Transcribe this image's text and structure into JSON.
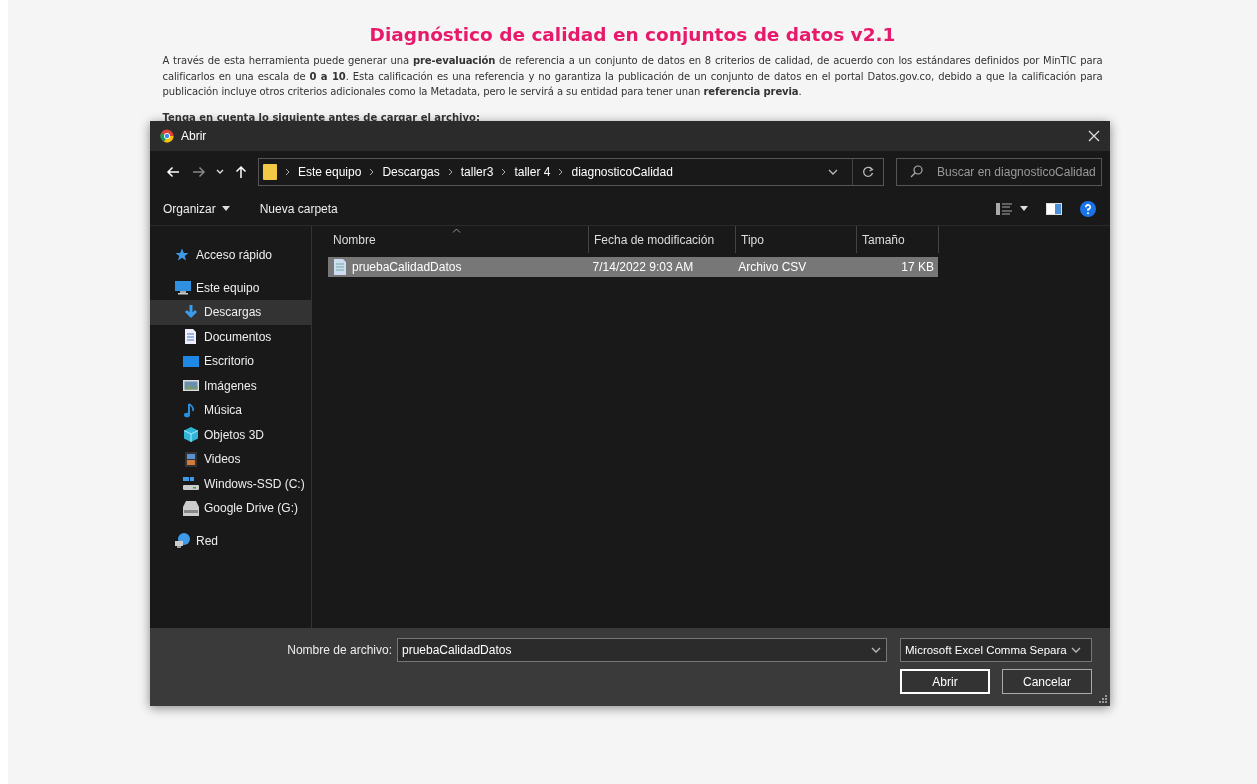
{
  "page": {
    "title": "Diagnóstico de calidad en conjuntos de datos v2.1",
    "intro": "A través de esta herramienta puede generar una **pre-evaluación** de referencia a un conjunto de datos en 8 criterios de calidad, de acuerdo con los estándares definidos por MinTIC para calificarlos en una escala de **0 a 10**. Esta calificación es una referencia y no garantiza la publicación de un conjunto de datos en el portal Datos.gov.co, debido a que la calificación para publicación incluye otros criterios adicionales como la Metadata, pero le servirá a su entidad para tener unan **referencia previa**.",
    "note": "Tenga en cuenta lo siguiente antes de cargar el archivo:"
  },
  "dialog": {
    "title": "Abrir",
    "path": [
      "Este equipo",
      "Descargas",
      "taller3",
      "taller 4",
      "diagnosticoCalidad"
    ],
    "search": {
      "placeholder": "Buscar en diagnosticoCalidad"
    },
    "toolbar": [
      "Organizar",
      "Nueva carpeta"
    ],
    "sidebar": {
      "items": [
        {
          "label": "Acceso rápido",
          "kind": "star",
          "selected": false
        },
        {
          "label": "Este equipo",
          "kind": "pc",
          "selected": false,
          "children": [
            {
              "label": "Descargas",
              "kind": "download",
              "selected": true
            },
            {
              "label": "Documentos",
              "kind": "doc",
              "selected": false
            },
            {
              "label": "Escritorio",
              "kind": "desktop",
              "selected": false
            },
            {
              "label": "Imágenes",
              "kind": "image",
              "selected": false
            },
            {
              "label": "Música",
              "kind": "music",
              "selected": false
            },
            {
              "label": "Objetos 3D",
              "kind": "cube",
              "selected": false
            },
            {
              "label": "Videos",
              "kind": "video",
              "selected": false
            },
            {
              "label": "Windows-SSD (C:)",
              "kind": "sysdrive",
              "selected": false
            },
            {
              "label": "Google Drive (G:)",
              "kind": "drive",
              "selected": false
            }
          ]
        },
        {
          "label": "Red",
          "kind": "network",
          "selected": false
        }
      ]
    },
    "table": {
      "columns": [
        "Nombre",
        "Fecha de modificación",
        "Tipo",
        "Tamaño"
      ],
      "rows": [
        {
          "cells": [
            "pruebaCalidadDatos",
            "7/14/2022 9:03 AM",
            "Archivo CSV",
            "17 KB"
          ],
          "selected": true
        }
      ]
    },
    "filename_label": "Nombre de archivo:",
    "filename": "pruebaCalidadDatos",
    "filetype": "Microsoft Excel Comma Separa",
    "buttons": [
      "Abrir",
      "Cancelar"
    ]
  }
}
